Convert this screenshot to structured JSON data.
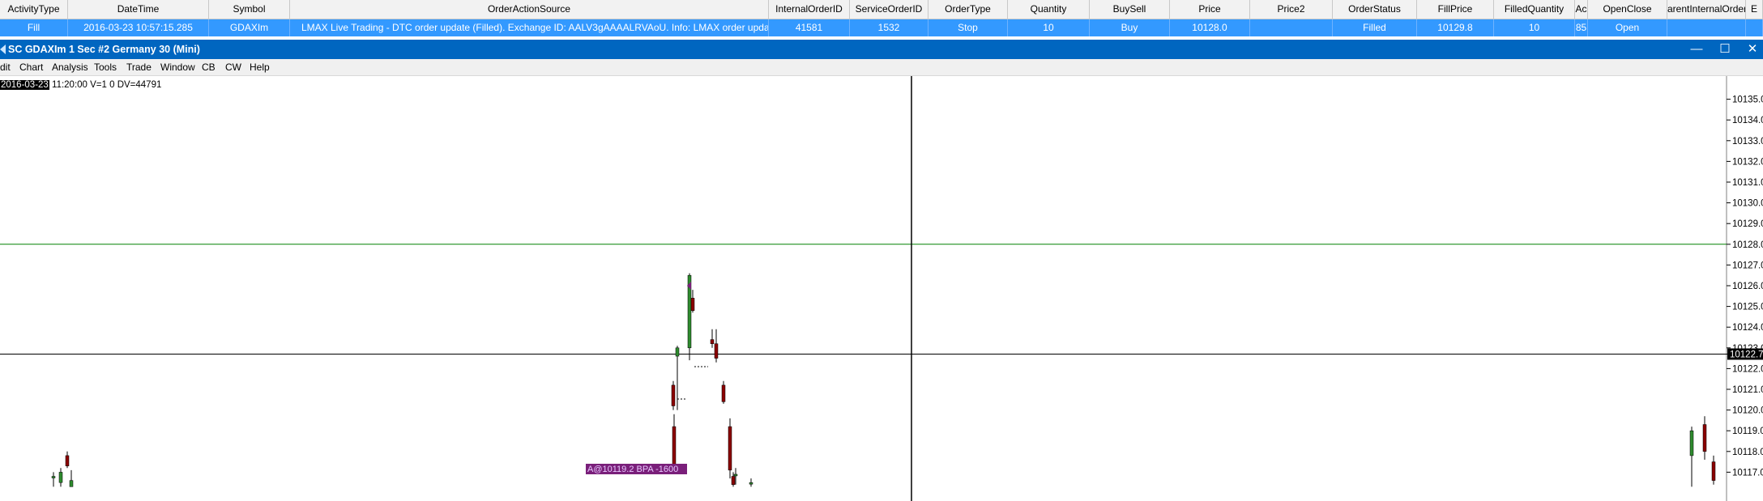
{
  "table": {
    "columns": [
      "ActivityType",
      "DateTime",
      "Symbol",
      "OrderActionSource",
      "InternalOrderID",
      "ServiceOrderID",
      "OrderType",
      "Quantity",
      "BuySell",
      "Price",
      "Price2",
      "OrderStatus",
      "FillPrice",
      "FilledQuantity",
      "Ac",
      "OpenClose",
      "arentInternalOrderI",
      "E"
    ],
    "row": [
      "Fill",
      "2016-03-23 10:57:15.285",
      "GDAXIm",
      "LMAX Live Trading - DTC order update (Filled). Exchange ID: AALV3gAAAALRVAoU. Info: LMAX order update (Trade)",
      "41581",
      "1532",
      "Stop",
      "10",
      "Buy",
      "10128.0",
      "",
      "Filled",
      "10129.8",
      "10",
      "85",
      "Open",
      "",
      ""
    ]
  },
  "window": {
    "title": "SC GDAXIm  1 Sec  #2 Germany 30 (Mini)",
    "minimize": "—",
    "maximize": "☐",
    "close": "✕"
  },
  "menu": [
    "dit",
    "Chart",
    "Analysis",
    "Tools",
    "Trade",
    "Window",
    "CB",
    "CW",
    "Help"
  ],
  "bar_info": {
    "date": "2016-03-23",
    "rest": " 11:20:00 V=1 0 DV=44791"
  },
  "price_axis": {
    "ticks": [
      "10135.0",
      "10134.0",
      "10133.0",
      "10132.0",
      "10131.0",
      "10130.0",
      "10129.0",
      "10128.0",
      "10127.0",
      "10126.0",
      "10125.0",
      "10124.0",
      "10123.0",
      "10122.0",
      "10121.0",
      "10120.0",
      "10119.0",
      "10118.0",
      "10117.0"
    ],
    "cursor_price": "10122.7"
  },
  "order_label": "A@10119.2 BPA -1600",
  "colors": {
    "up_bar": "#2e8b2e",
    "down_bar": "#8b0000",
    "fill_line": "#008000",
    "cursor": "#000000",
    "label_bg": "#7a1f7a",
    "title_bar": "#0066c0"
  },
  "chart_data": {
    "type": "candlestick",
    "ylim": [
      10116.2,
      10136.0
    ],
    "fill_price_line": 10128.0,
    "cursor_price": 10122.7,
    "bars": [
      {
        "o": 10116.8,
        "h": 10117.0,
        "l": 10116.3,
        "c": 10116.8
      },
      {
        "o": 10116.5,
        "h": 10117.2,
        "l": 10116.3,
        "c": 10117.0
      },
      {
        "o": 10117.8,
        "h": 10118.0,
        "l": 10117.2,
        "c": 10117.3
      },
      {
        "o": 10116.3,
        "h": 10117.1,
        "l": 10116.3,
        "c": 10116.6
      },
      {
        "o": 10119.2,
        "h": 10119.8,
        "l": 10117.0,
        "c": 10117.1
      },
      {
        "o": 10121.2,
        "h": 10121.4,
        "l": 10120.0,
        "c": 10120.2
      },
      {
        "o": 10122.6,
        "h": 10123.1,
        "l": 10120.0,
        "c": 10123.0
      },
      {
        "o": 10123.0,
        "h": 10126.6,
        "l": 10122.4,
        "c": 10126.5
      },
      {
        "o": 10125.4,
        "h": 10125.8,
        "l": 10124.7,
        "c": 10124.8
      },
      {
        "o": 10123.4,
        "h": 10123.9,
        "l": 10123.0,
        "c": 10123.2
      },
      {
        "o": 10123.2,
        "h": 10123.9,
        "l": 10122.3,
        "c": 10122.5
      },
      {
        "o": 10121.2,
        "h": 10121.4,
        "l": 10120.3,
        "c": 10120.4
      },
      {
        "o": 10119.2,
        "h": 10119.6,
        "l": 10116.7,
        "c": 10117.1
      },
      {
        "o": 10116.8,
        "h": 10117.0,
        "l": 10116.3,
        "c": 10116.4
      },
      {
        "o": 10116.9,
        "h": 10117.2,
        "l": 10116.4,
        "c": 10116.9
      },
      {
        "o": 10116.5,
        "h": 10116.7,
        "l": 10116.3,
        "c": 10116.5
      },
      {
        "o": 10117.8,
        "h": 10119.2,
        "l": 10116.3,
        "c": 10119.0
      },
      {
        "o": 10119.3,
        "h": 10119.7,
        "l": 10117.6,
        "c": 10118.0
      },
      {
        "o": 10117.5,
        "h": 10117.8,
        "l": 10116.4,
        "c": 10116.6
      }
    ]
  }
}
